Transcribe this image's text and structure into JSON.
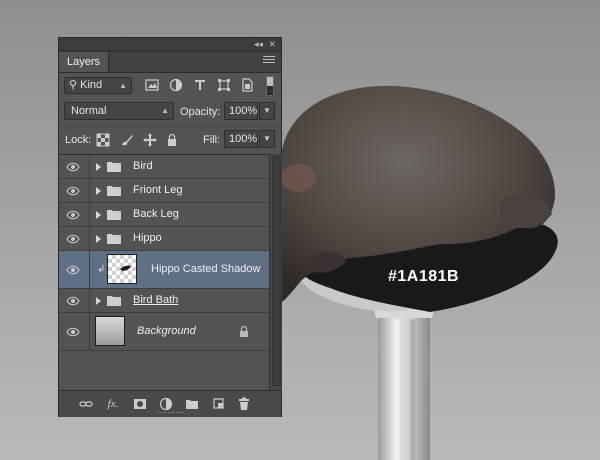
{
  "panel": {
    "tab_label": "Layers",
    "filter_kind": "Kind",
    "blend_mode": "Normal",
    "opacity_label": "Opacity:",
    "opacity_value": "100%",
    "lock_label": "Lock:",
    "fill_label": "Fill:",
    "fill_value": "100%"
  },
  "layers": [
    {
      "name": "Bird",
      "type": "group"
    },
    {
      "name": "Friont Leg",
      "type": "group"
    },
    {
      "name": "Back Leg",
      "type": "group"
    },
    {
      "name": "Hippo",
      "type": "group"
    },
    {
      "name": "Hippo Casted Shadow",
      "type": "layer",
      "selected": true
    },
    {
      "name": "Bird Bath",
      "type": "group"
    },
    {
      "name": "Background",
      "type": "background"
    }
  ],
  "canvas": {
    "color_label": "#1A181B",
    "shadow_color": "#1A181B"
  },
  "bottom_icons": [
    "link-icon",
    "fx-icon",
    "mask-icon",
    "adjustment-icon",
    "new-group-icon",
    "new-layer-icon",
    "trash-icon"
  ]
}
